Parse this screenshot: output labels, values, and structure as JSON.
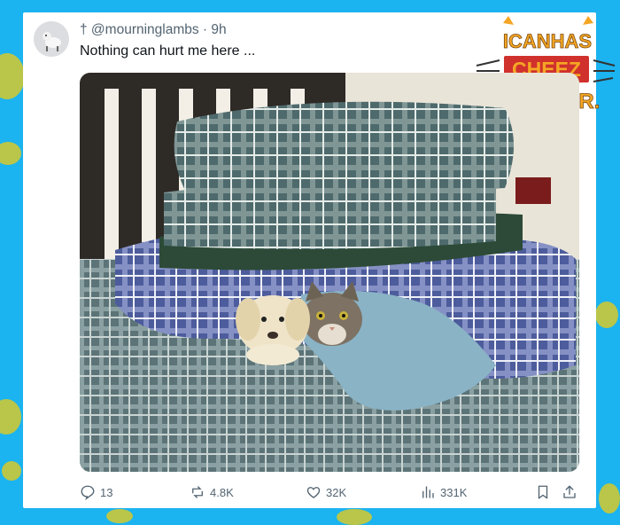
{
  "tweet": {
    "author": "† @mourninglambs · 9h",
    "text": "Nothing can hurt me here ..."
  },
  "actions": {
    "replies": "13",
    "reposts": "4.8K",
    "likes": "32K",
    "views": "331K"
  },
  "watermark": {
    "line1": "ICANHAS",
    "line2": "CHEEZ",
    "line3": "BURGER."
  },
  "colors": {
    "background": "#1bb3f0",
    "paw": "#b9c64a",
    "logo_orange": "#f5a623",
    "logo_red": "#d0312d"
  },
  "icons": {
    "reply": "reply-icon",
    "repost": "repost-icon",
    "like": "heart-icon",
    "views": "views-icon",
    "bookmark": "bookmark-icon",
    "share": "share-icon"
  }
}
